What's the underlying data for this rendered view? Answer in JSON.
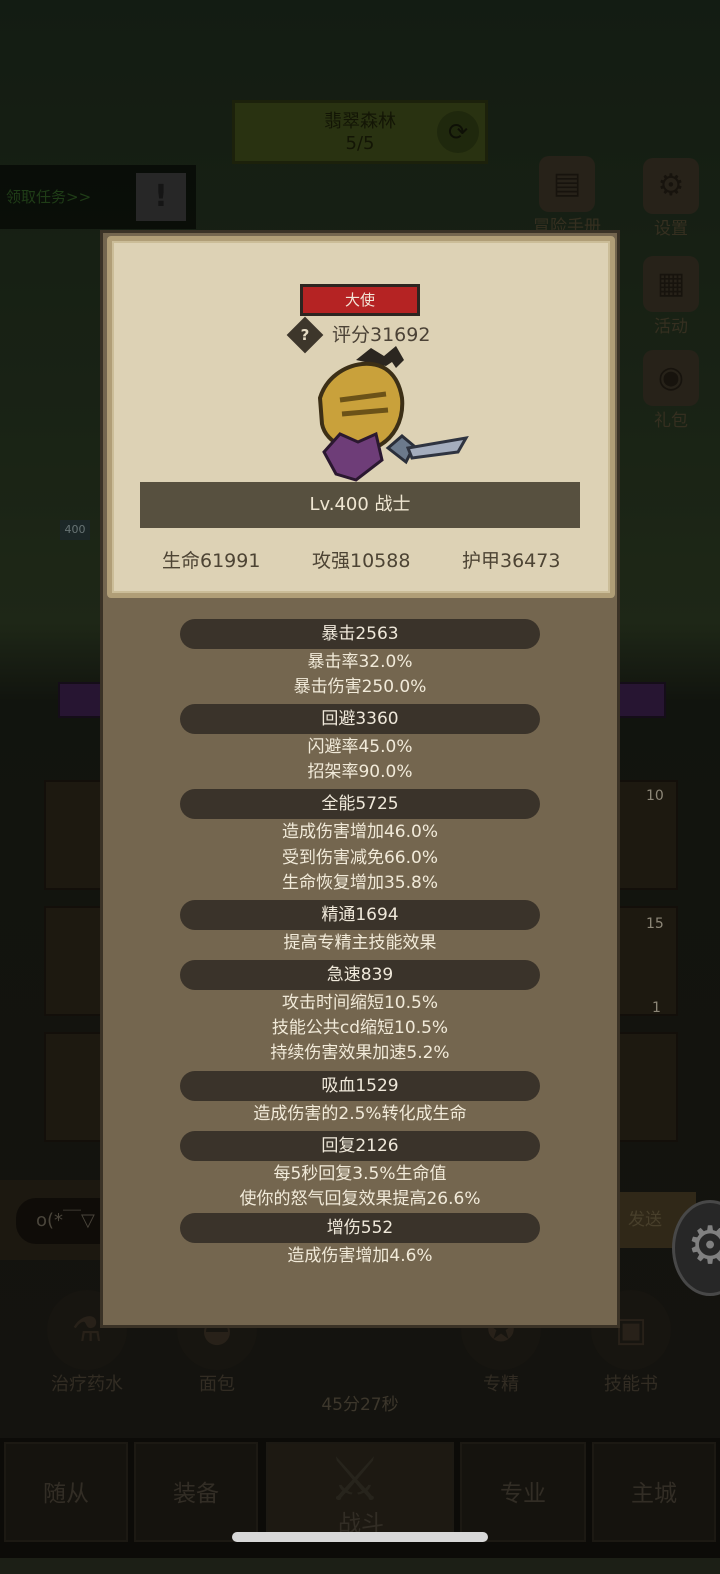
{
  "background": {
    "zone": {
      "name": "翡翠森林",
      "progress": "5/5"
    },
    "quest_label": "领取任务>>",
    "side_menu": [
      {
        "label": "冒险手册",
        "icon": "book-icon"
      },
      {
        "label": "设置",
        "icon": "gear-icon"
      },
      {
        "label": "活动",
        "icon": "scroll-icon"
      },
      {
        "label": "礼包",
        "icon": "gift-icon"
      }
    ],
    "slot_counts": [
      "10",
      "15",
      "1"
    ],
    "level_badge": "400",
    "chat_placeholder": "o(*￣▽",
    "send_label": "发送",
    "actions": [
      {
        "label": "治疗药水",
        "icon": "potion-icon"
      },
      {
        "label": "面包",
        "icon": "bread-icon"
      },
      {
        "label": "专精",
        "icon": "specialization-icon"
      },
      {
        "label": "技能书",
        "icon": "skillbook-icon"
      }
    ],
    "timer": "45分27秒",
    "nav": [
      "随从",
      "装备",
      "战斗",
      "专业",
      "主城"
    ]
  },
  "dialog": {
    "title": "大使",
    "score": "评分31692",
    "level": "Lv.400 战士",
    "core_stats": [
      "生命61991",
      "攻强10588",
      "护甲36473"
    ],
    "stats": [
      {
        "name": "暴击2563",
        "details": [
          "暴击率32.0%",
          "暴击伤害250.0%"
        ]
      },
      {
        "name": "回避3360",
        "details": [
          "闪避率45.0%",
          "招架率90.0%"
        ]
      },
      {
        "name": "全能5725",
        "details": [
          "造成伤害增加46.0%",
          "受到伤害减免66.0%",
          "生命恢复增加35.8%"
        ]
      },
      {
        "name": "精通1694",
        "details": [
          "提高专精主技能效果"
        ]
      },
      {
        "name": "急速839",
        "details": [
          "攻击时间缩短10.5%",
          "技能公共cd缩短10.5%",
          "持续伤害效果加速5.2%"
        ]
      },
      {
        "name": "吸血1529",
        "details": [
          "造成伤害的2.5%转化成生命"
        ]
      },
      {
        "name": "回复2126",
        "details": [
          "每5秒回复3.5%生命值",
          "使你的怒气回复效果提高26.6%"
        ]
      },
      {
        "name": "增伤552",
        "details": [
          "造成伤害增加4.6%"
        ]
      }
    ]
  }
}
